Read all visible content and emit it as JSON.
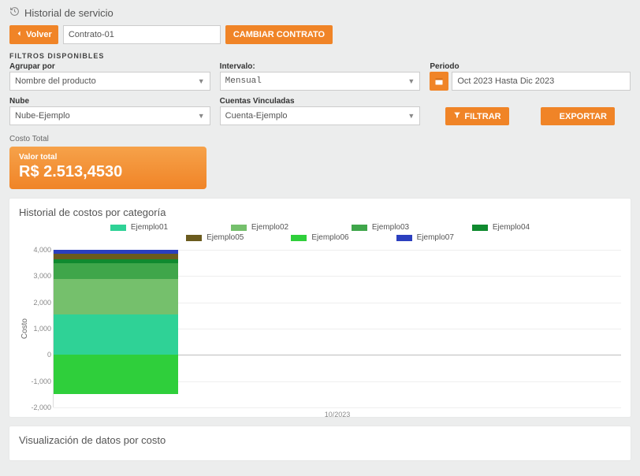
{
  "page": {
    "title": "Historial de servicio"
  },
  "topbar": {
    "back_label": "Volver",
    "contract_value": "Contrato-01",
    "change_contract_label": "CAMBIAR CONTRATO"
  },
  "filters": {
    "available_label": "FILTROS DISPONIBLES",
    "group_by": {
      "label": "Agrupar por",
      "value": "Nombre del producto"
    },
    "interval": {
      "label": "Intervalo:",
      "value": "Mensual"
    },
    "period": {
      "label": "Periodo",
      "value": "Oct 2023 Hasta Dic 2023"
    },
    "cloud": {
      "label": "Nube",
      "value": "Nube-Ejemplo"
    },
    "accounts": {
      "label": "Cuentas Vinculadas",
      "value": "Cuenta-Ejemplo"
    },
    "filter_button": "FILTRAR",
    "export_button": "EXPORTAR"
  },
  "total": {
    "section_label": "Costo Total",
    "card_label": "Valor total",
    "card_value": "R$ 2.513,4530"
  },
  "panel_chart": {
    "title": "Historial de costos por categoría"
  },
  "panel_data": {
    "title": "Visualización de datos por costo"
  },
  "chart_data": {
    "type": "bar",
    "stacked": true,
    "title": "Historial de costos por categoría",
    "ylabel": "Costo",
    "xlabel": "",
    "categories": [
      "10/2023"
    ],
    "ylim": [
      -2000,
      4000
    ],
    "yticks": [
      -2000,
      -1000,
      0,
      1000,
      2000,
      3000,
      4000
    ],
    "series": [
      {
        "name": "Ejemplo01",
        "color": "#2fd296",
        "values": [
          1550
        ]
      },
      {
        "name": "Ejemplo02",
        "color": "#75c06c",
        "values": [
          1350
        ]
      },
      {
        "name": "Ejemplo03",
        "color": "#3fa64a",
        "values": [
          600
        ]
      },
      {
        "name": "Ejemplo04",
        "color": "#0f8a2f",
        "values": [
          150
        ]
      },
      {
        "name": "Ejemplo05",
        "color": "#6b5b1e",
        "values": [
          200
        ]
      },
      {
        "name": "Ejemplo06",
        "color": "#2fcf3b",
        "values": [
          -1500
        ]
      },
      {
        "name": "Ejemplo07",
        "color": "#2b3fbf",
        "values": [
          150
        ]
      }
    ]
  }
}
